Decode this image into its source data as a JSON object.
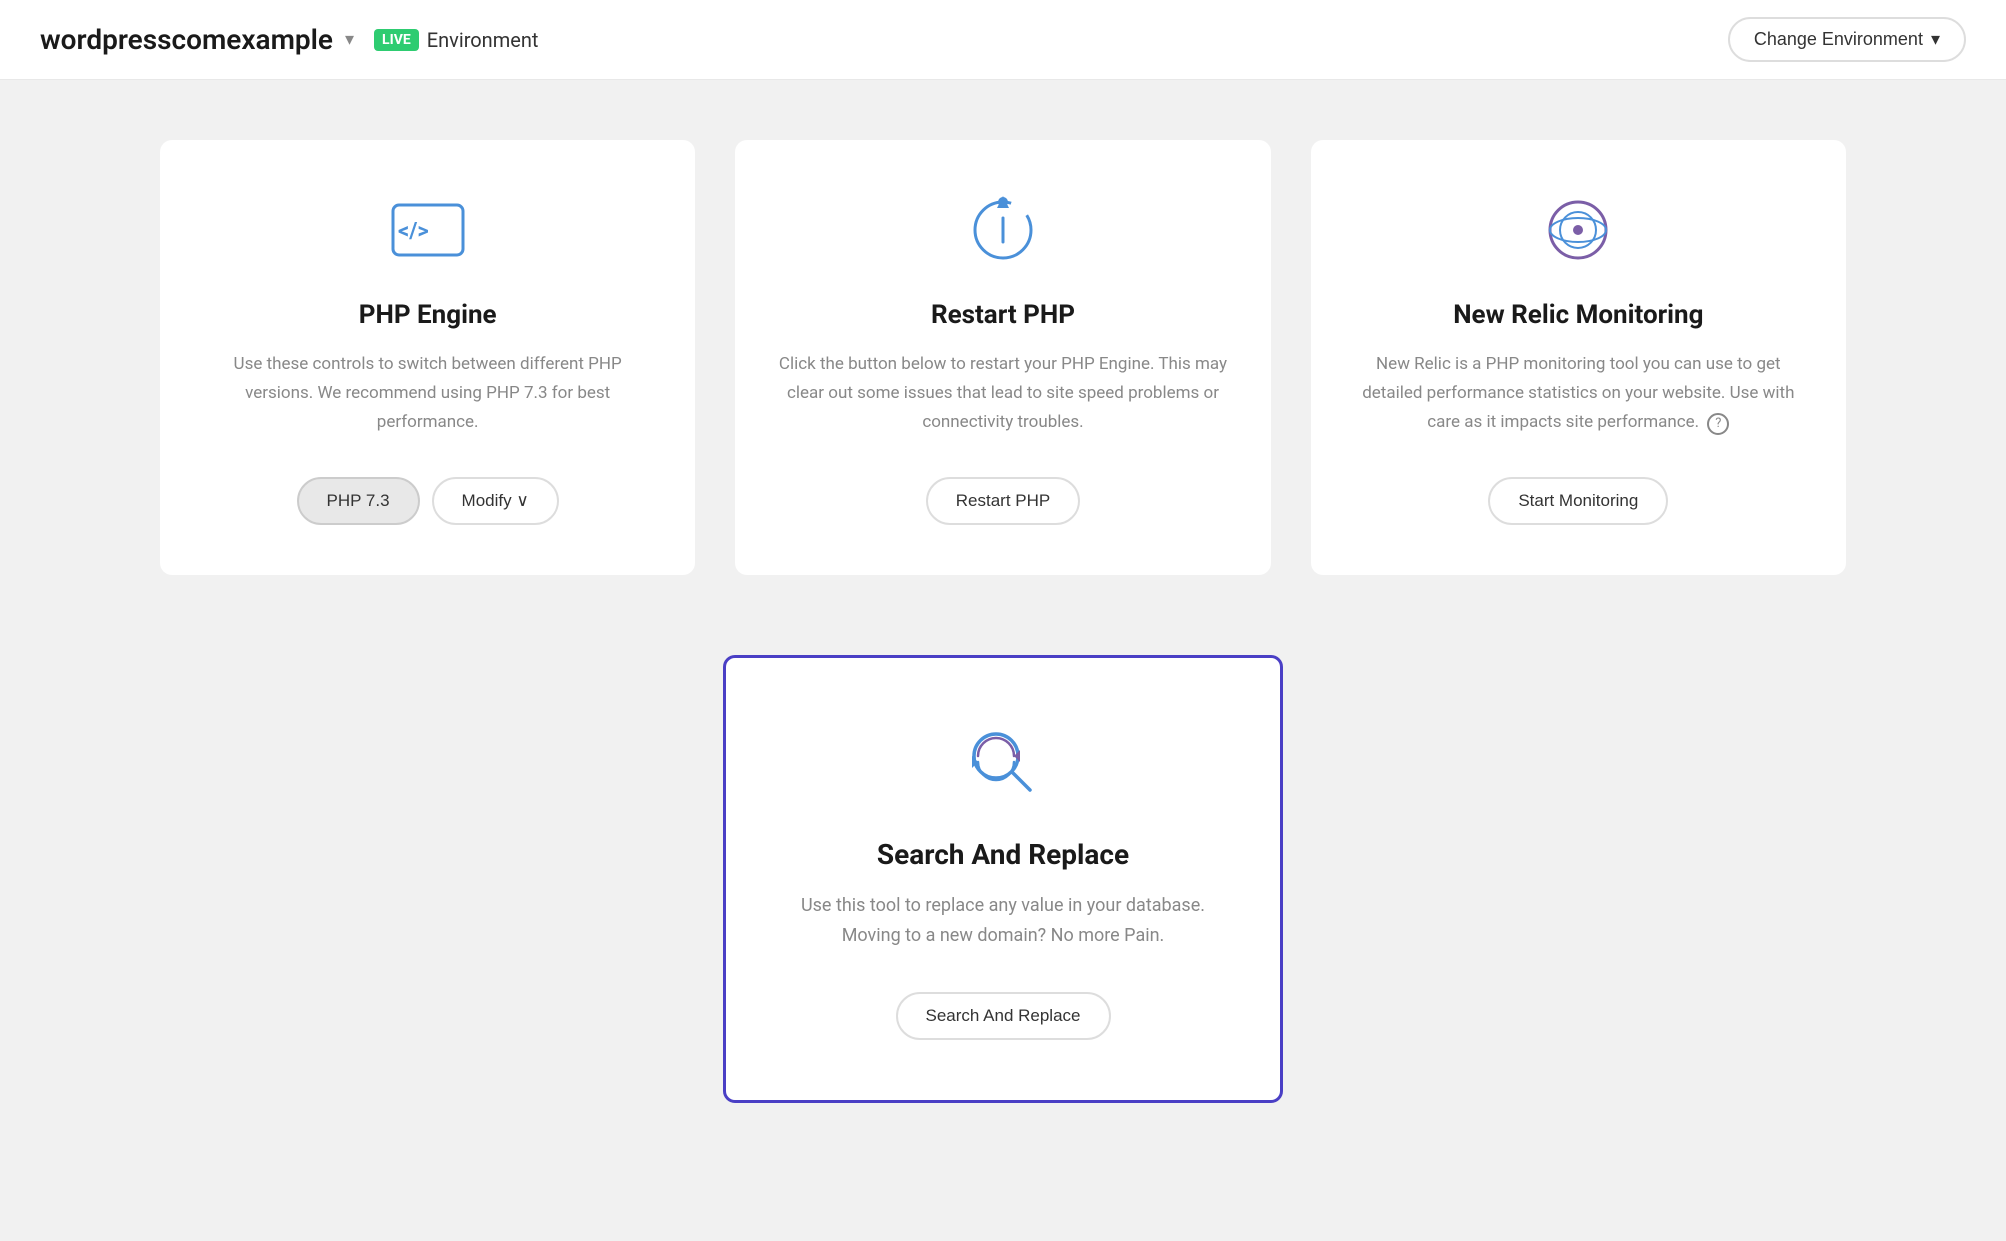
{
  "header": {
    "site_name": "wordpresscomexample",
    "dropdown_chevron": "▾",
    "live_badge": "LIVE",
    "environment_label": "Environment",
    "change_env_btn": "Change Environment",
    "change_env_chevron": "▾"
  },
  "cards": [
    {
      "id": "php-engine",
      "title": "PHP Engine",
      "description": "Use these controls to switch between different PHP versions. We recommend using PHP 7.3 for best performance.",
      "current_version": "PHP 7.3",
      "btn_label": "Modify ∨"
    },
    {
      "id": "restart-php",
      "title": "Restart PHP",
      "description": "Click the button below to restart your PHP Engine. This may clear out some issues that lead to site speed problems or connectivity troubles.",
      "btn_label": "Restart PHP"
    },
    {
      "id": "new-relic",
      "title": "New Relic Monitoring",
      "description": "New Relic is a PHP monitoring tool you can use to get detailed performance statistics on your website. Use with care as it impacts site performance.",
      "btn_label": "Start Monitoring",
      "help": "?"
    }
  ],
  "featured_card": {
    "id": "search-and-replace",
    "title": "Search And Replace",
    "description": "Use this tool to replace any value in your database. Moving to a new domain? No more Pain.",
    "btn_label": "Search And Replace"
  }
}
